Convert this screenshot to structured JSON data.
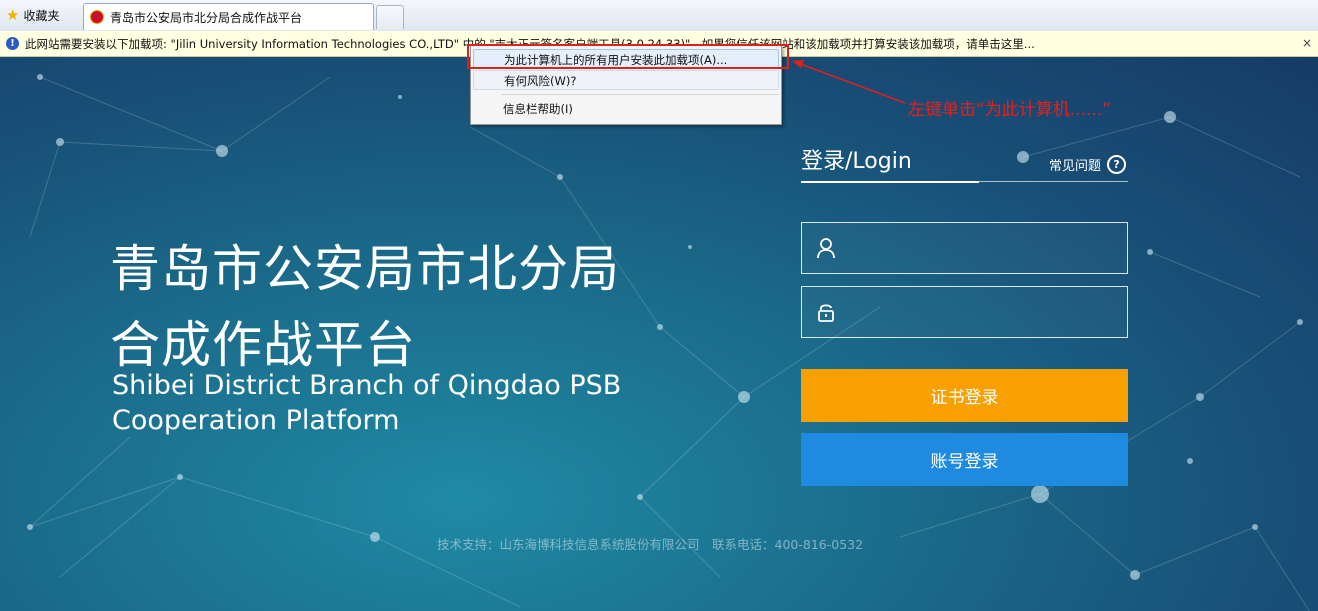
{
  "browser": {
    "favorites_label": "收藏夹",
    "tab_title": "青岛市公安局市北分局合成作战平台"
  },
  "infobar": {
    "message": "此网站需要安装以下加载项: \"Jilin University Information Technologies CO.,LTD\" 中的 \"吉大正元签名客户端工具(3.0.24.33)\"。如果您信任该网站和该加载项并打算安装该加载项，请单击这里...",
    "close_glyph": "×"
  },
  "context_menu": {
    "items": [
      {
        "label": "为此计算机上的所有用户安装此加载项(A)..."
      },
      {
        "label": "有何风险(W)?"
      },
      {
        "label": "信息栏帮助(I)"
      }
    ]
  },
  "annotation": {
    "text": "左键单击“为此计算机......”",
    "color": "#e8201a"
  },
  "page": {
    "title_cn_line1": "青岛市公安局市北分局",
    "title_cn_line2": "合成作战平台",
    "title_en_line1": "Shibei District Branch of Qingdao PSB",
    "title_en_line2": "Cooperation Platform",
    "login_heading": "登录/Login",
    "faq_label": "常见问题",
    "faq_icon": "?",
    "username": {
      "value": "",
      "icon": "user-icon"
    },
    "password": {
      "value": "",
      "icon": "lock-icon"
    },
    "cert_login_button": "证书登录",
    "account_login_button": "账号登录",
    "footer": "技术支持：山东海博科技信息系统股份有限公司　联系电话：400-816-0532"
  },
  "colors": {
    "cert_button": "#f7a000",
    "account_button": "#1e8be0",
    "background_dark": "#163b66",
    "background_light": "#1f8aa4"
  }
}
